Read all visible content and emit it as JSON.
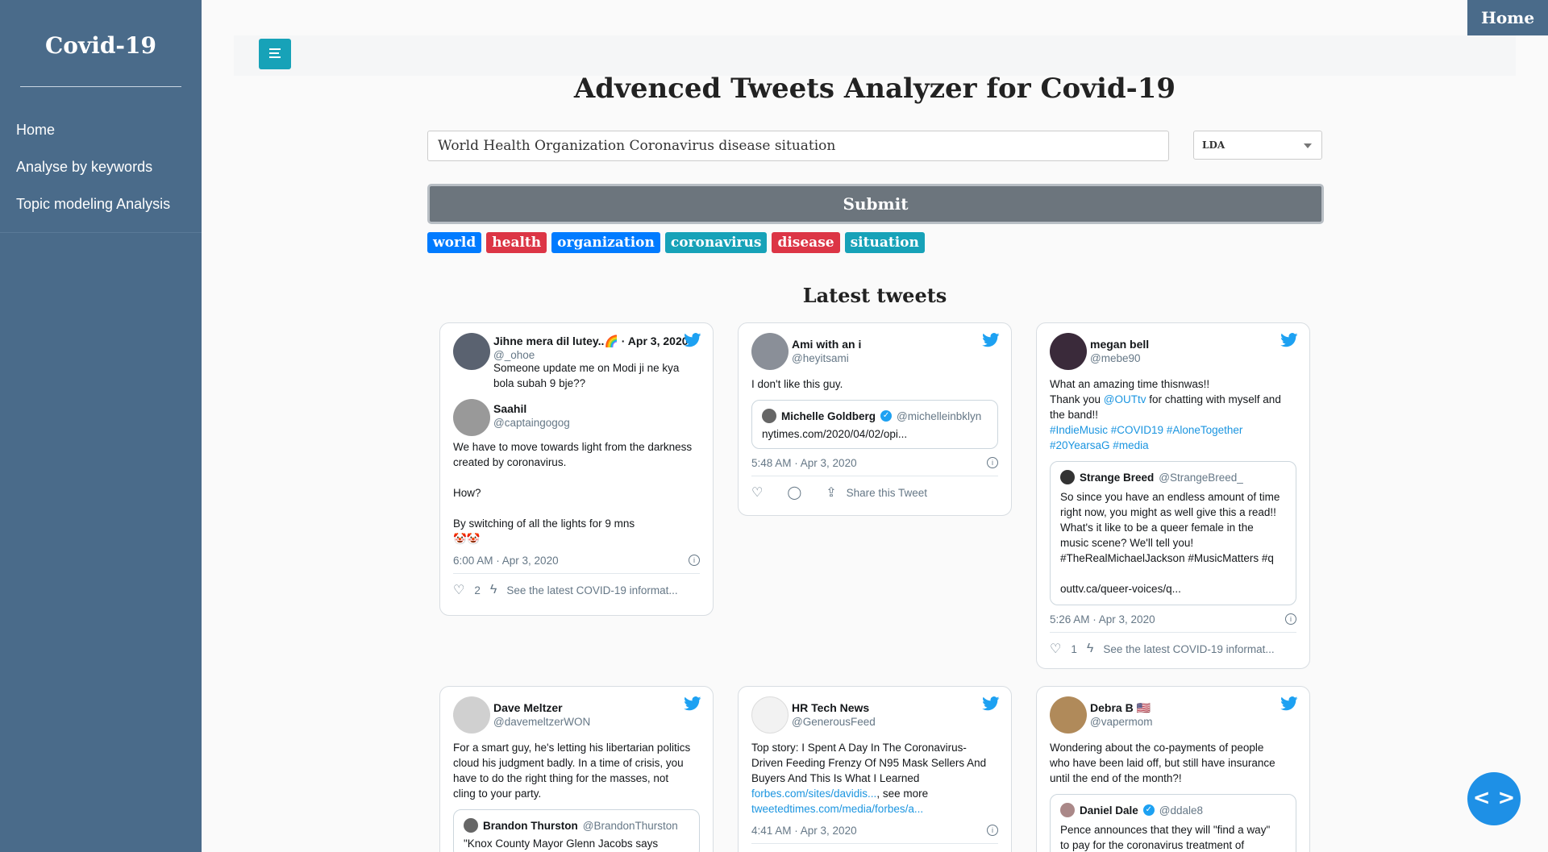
{
  "sidebar": {
    "brand": "Covid-19",
    "items": [
      {
        "label": "Home"
      },
      {
        "label": "Analyse by keywords"
      },
      {
        "label": "Topic modeling Analysis"
      }
    ]
  },
  "header": {
    "home_label": "Home",
    "title": "Advenced Tweets Analyzer for Covid-19"
  },
  "search": {
    "value": "World Health Organization Coronavirus disease situation",
    "method": "LDA",
    "submit_label": "Submit"
  },
  "tags": [
    {
      "label": "world",
      "color": "#007bff"
    },
    {
      "label": "health",
      "color": "#dc3545"
    },
    {
      "label": "organization",
      "color": "#007bff"
    },
    {
      "label": "coronavirus",
      "color": "#17a2b8"
    },
    {
      "label": "disease",
      "color": "#dc3545"
    },
    {
      "label": "situation",
      "color": "#17a2b8"
    }
  ],
  "latest_title": "Latest tweets",
  "tweets": {
    "t1": {
      "name": "Jihne mera dil lutey..🌈 · Apr 3, 2020",
      "handle": "@_ohoe",
      "text": "Someone update me on Modi ji ne kya\nbola subah 9 bje??",
      "reply_name": "Saahil",
      "reply_handle": "@captaingogog",
      "reply_text": "We have to move towards light from the darkness\ncreated by coronavirus.\n\nHow?\n\nBy switching of all the lights for 9 mns\n🤡🤡",
      "time": "6:00 AM · Apr 3, 2020",
      "likes": "2",
      "action": "See the latest COVID-19 informat..."
    },
    "t2": {
      "name": "Ami with an i",
      "handle": "@heyitsami",
      "text": "I don't like this guy.",
      "quote_name": "Michelle Goldberg",
      "quote_handle": "@michelleinbklyn",
      "quote_text": "nytimes.com/2020/04/02/opi...",
      "time": "5:48 AM · Apr 3, 2020",
      "action": "Share this Tweet"
    },
    "t3": {
      "name": "megan bell",
      "handle": "@mebe90",
      "text_a": "What an amazing time thisnwas!!\nThank you ",
      "text_link": "@OUTtv",
      "text_b": " for chatting with myself and\nthe band!!",
      "hashtags": "#IndieMusic #COVID19 #AloneTogether\n#20YearsaG #media",
      "quote_name": "Strange Breed",
      "quote_handle": "@StrangeBreed_",
      "quote_text": "So since you have an endless amount of time\nright now, you might as well give this a read!!\nWhat's it like to be a queer female in the\nmusic scene? We'll tell you!\n#TheRealMichaelJackson #MusicMatters #q\n\nouttv.ca/queer-voices/q...",
      "time": "5:26 AM · Apr 3, 2020",
      "likes": "1",
      "action": "See the latest COVID-19 informat..."
    },
    "t4": {
      "name": "Dave Meltzer",
      "handle": "@davemeltzerWON",
      "text": "For a smart guy, he's letting his libertarian politics\ncloud his judgment badly.  In a time of crisis, you\nhave to do the right thing for the masses, not\ncling to your party.",
      "quote_name": "Brandon Thurston",
      "quote_handle": "@BrandonThurston",
      "quote_text": "\"Knox County Mayor Glenn Jacobs says"
    },
    "t5": {
      "name": "HR Tech News",
      "handle": "@GenerousFeed",
      "text": "Top story: I Spent A Day In The Coronavirus-\nDriven Feeding Frenzy Of N95 Mask Sellers And\nBuyers And This Is What I Learned",
      "link1": "forbes.com/sites/davidis...",
      "more": ", see more",
      "link2": "tweetedtimes.com/media/forbes/a...",
      "time": "4:41 AM · Apr 3, 2020"
    },
    "t6": {
      "name": "Debra B 🇺🇸",
      "handle": "@vapermom",
      "text": "Wondering about the co-payments of people\nwho have been laid off, but still have insurance\nuntil the end of the month?!",
      "quote_name": "Daniel Dale",
      "quote_handle": "@ddale8",
      "quote_text": "Pence announces that they will \"find a way\"\nto pay for the coronavirus treatment of"
    }
  },
  "fab_label": "< >"
}
